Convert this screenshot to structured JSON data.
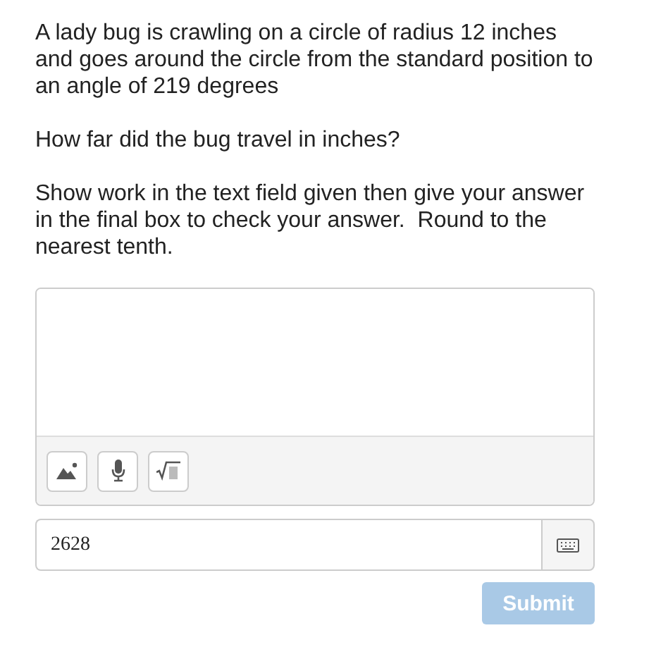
{
  "question": {
    "paragraphs": [
      "A lady bug is crawling on a circle of radius 12 inches and goes around the circle from the standard position to an angle of 219 degrees",
      "How far did the bug travel in inches?",
      "Show work in the text field given then give your answer in the final box to check your answer.  Round to the nearest tenth."
    ]
  },
  "work_editor": {
    "tools": [
      {
        "kind": "image"
      },
      {
        "kind": "mic"
      },
      {
        "kind": "math"
      }
    ]
  },
  "answer": {
    "value": "2628"
  },
  "submit": {
    "label": "Submit",
    "disabled": true
  }
}
